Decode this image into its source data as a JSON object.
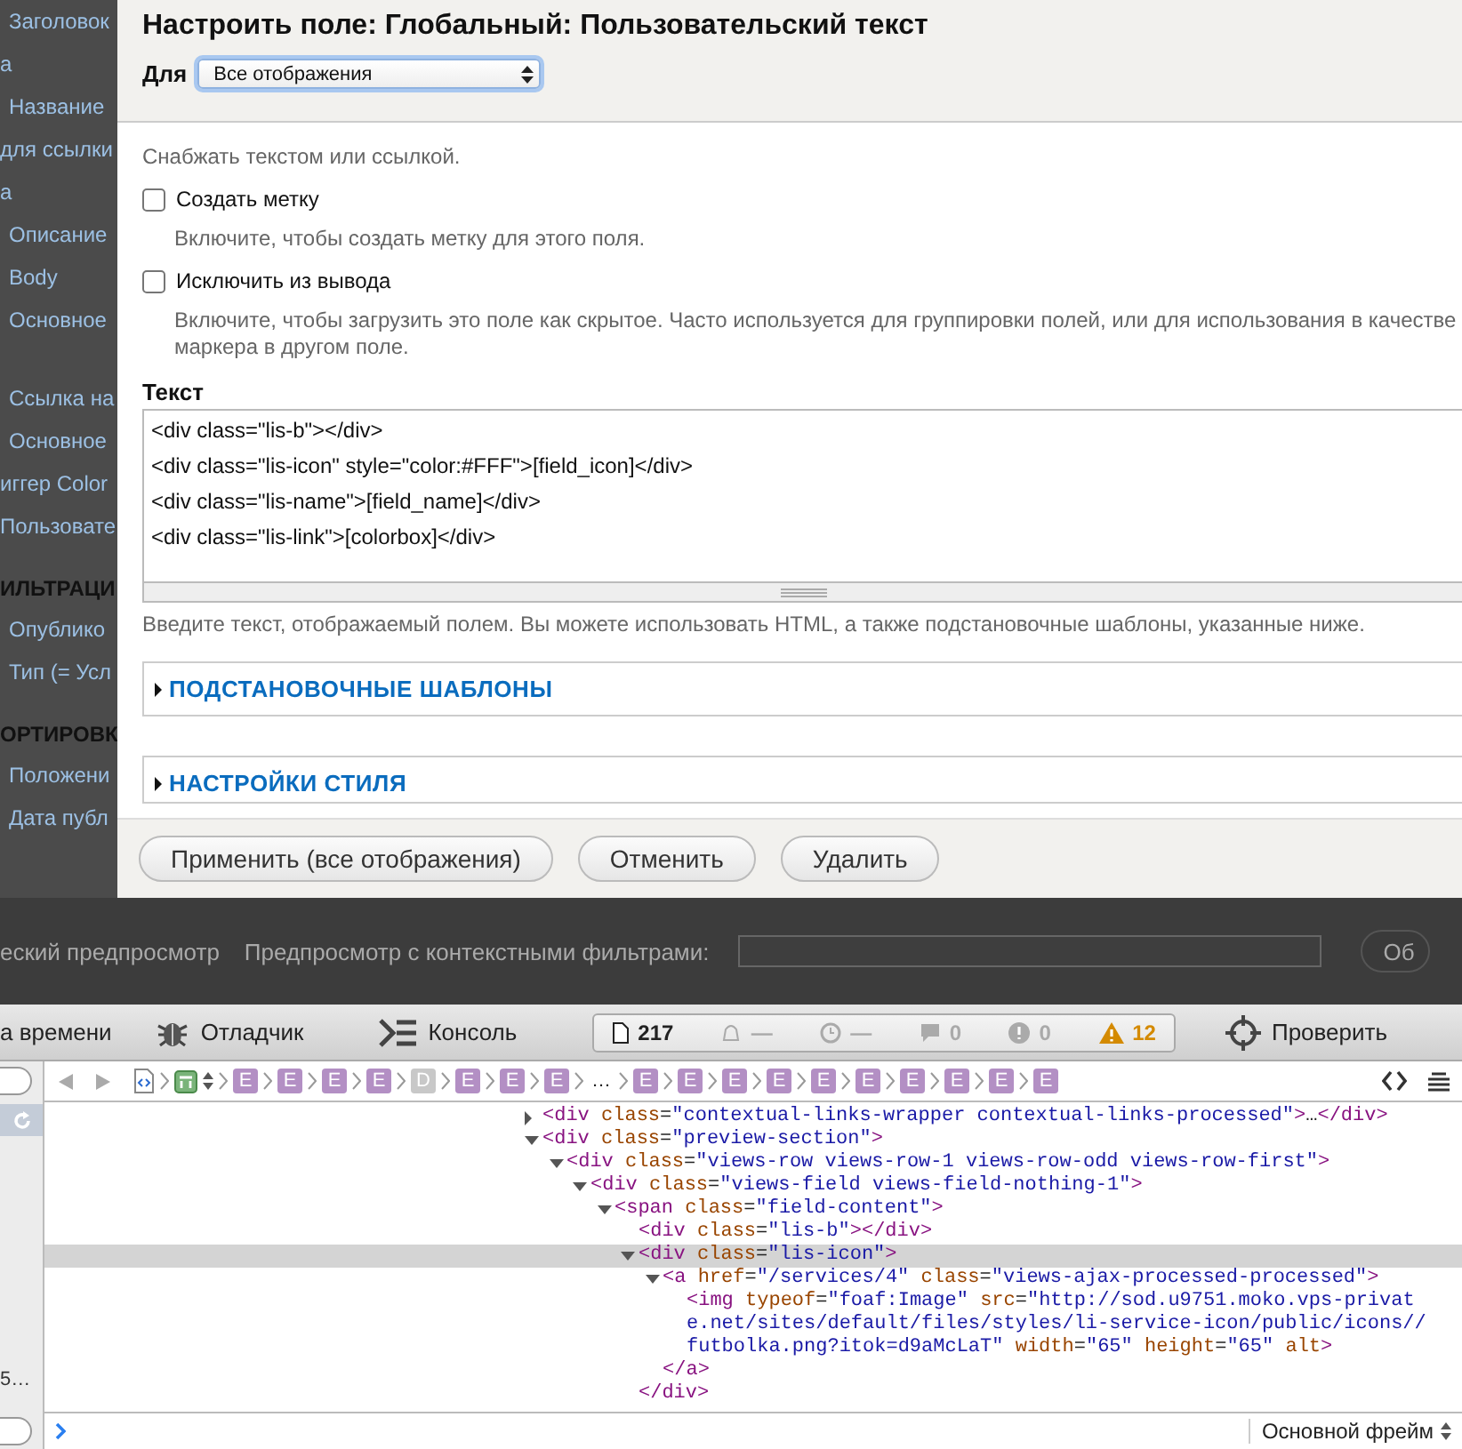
{
  "sidebar": {
    "groups": [
      {
        "items": [
          {
            "label": "Заголовок",
            "kind": "link"
          },
          {
            "label": "а",
            "kind": "continuation"
          },
          {
            "label": "Название",
            "kind": "link"
          },
          {
            "label": "для ссылки",
            "kind": "continuation"
          },
          {
            "label": "а",
            "kind": "continuation"
          },
          {
            "label": "Описание",
            "kind": "link"
          },
          {
            "label": "Body",
            "kind": "link"
          },
          {
            "label": "Основное",
            "kind": "link"
          }
        ]
      },
      {
        "items": [
          {
            "label": "Ссылка на",
            "kind": "link"
          },
          {
            "label": "Основное",
            "kind": "link"
          },
          {
            "label": "иггер Color",
            "kind": "continuation"
          },
          {
            "label": "Пользовате",
            "kind": "continuation"
          }
        ]
      },
      {
        "heading": "ИЛЬТРАЦИ",
        "items": [
          {
            "label": "Опублико",
            "kind": "link"
          },
          {
            "label": "Тип (= Усл",
            "kind": "link"
          }
        ]
      },
      {
        "heading": "ОРТИРОВК",
        "items": [
          {
            "label": "Положени",
            "kind": "link"
          },
          {
            "label": "Дата публ",
            "kind": "link"
          }
        ]
      }
    ]
  },
  "dialog": {
    "title": "Настроить поле: Глобальный: Пользовательский текст",
    "for_label": "Для",
    "for_select": "Все отображения",
    "description": "Снабжать текстом или ссылкой.",
    "options": [
      {
        "label": "Создать метку",
        "checked": false,
        "hint": "Включите, чтобы создать метку для этого поля."
      },
      {
        "label": "Исключить из вывода",
        "checked": false,
        "hint": "Включите, чтобы загрузить это поле как скрытое. Часто используется для группировки полей, или для использования в качестве маркера в другом поле."
      }
    ],
    "text_label": "Текст",
    "text_lines": [
      "<div class=\"lis-b\"></div>",
      "<div class=\"lis-icon\" style=\"color:#FFF\">[field_icon]</div>",
      "<div class=\"lis-name\">[field_name]</div>",
      "<div class=\"lis-link\">[colorbox]</div>"
    ],
    "text_hint": "Введите текст, отображаемый полем. Вы можете использовать HTML, а также подстановочные шаблоны, указанные ниже.",
    "sections": [
      {
        "label": "ПОДСТАНОВОЧНЫЕ ШАБЛОНЫ",
        "expanded": false
      },
      {
        "label": "НАСТРОЙКИ СТИЛЯ",
        "expanded": false
      }
    ],
    "buttons": [
      "Применить (все отображения)",
      "Отменить",
      "Удалить"
    ]
  },
  "preview_bar": {
    "left_text": "еский предпросмотр",
    "filter_label": "Предпросмотр с контекстными фильтрами:",
    "button": "Об"
  },
  "devtools": {
    "tabs": [
      {
        "label": "а времени",
        "kind": "timeline"
      },
      {
        "label": "Отладчик",
        "kind": "debugger"
      },
      {
        "label": "Консоль",
        "kind": "console"
      }
    ],
    "counters": [
      {
        "kind": "resources",
        "value": "217"
      },
      {
        "kind": "network",
        "value": "—"
      },
      {
        "kind": "time",
        "value": "—"
      },
      {
        "kind": "logs",
        "value": "0"
      },
      {
        "kind": "errors",
        "value": "0"
      },
      {
        "kind": "warnings",
        "value": "12"
      }
    ],
    "inspect": "Проверить",
    "breadcrumbs": [
      {
        "kind": "element",
        "label": "E"
      },
      {
        "kind": "element",
        "label": "E"
      },
      {
        "kind": "element",
        "label": "E"
      },
      {
        "kind": "element",
        "label": "E"
      },
      {
        "kind": "document",
        "label": "D"
      },
      {
        "kind": "element",
        "label": "E"
      },
      {
        "kind": "element",
        "label": "E"
      },
      {
        "kind": "element",
        "label": "E"
      },
      {
        "kind": "ellipsis",
        "label": "…"
      },
      {
        "kind": "element",
        "label": "E"
      },
      {
        "kind": "element",
        "label": "E"
      },
      {
        "kind": "element",
        "label": "E"
      },
      {
        "kind": "element",
        "label": "E"
      },
      {
        "kind": "element",
        "label": "E"
      },
      {
        "kind": "element",
        "label": "E"
      },
      {
        "kind": "element",
        "label": "E"
      },
      {
        "kind": "element",
        "label": "E"
      },
      {
        "kind": "element",
        "label": "E"
      },
      {
        "kind": "element",
        "label": "E"
      }
    ],
    "side_text": "5…",
    "dom": [
      {
        "text": "<div class=\"contextual-links-wrapper contextual-links-processed\">…</div>",
        "kind": "parent",
        "expanded": false,
        "selected": false
      },
      {
        "text": "<div class=\"preview-section\">",
        "kind": "parent",
        "expanded": true,
        "selected": false,
        "children": [
          {
            "text": "<div class=\"views-row views-row-1 views-row-odd views-row-first\">",
            "kind": "parent",
            "expanded": true,
            "selected": false,
            "children": [
              {
                "text": "<div class=\"views-field views-field-nothing-1\">",
                "kind": "parent",
                "expanded": true,
                "selected": false,
                "children": [
                  {
                    "text": "<span class=\"field-content\">",
                    "kind": "parent",
                    "expanded": true,
                    "selected": false,
                    "children": [
                      {
                        "text": "<div class=\"lis-b\"></div>",
                        "kind": "leaf",
                        "selected": false
                      },
                      {
                        "text": "<div class=\"lis-icon\">",
                        "kind": "parent",
                        "expanded": true,
                        "selected": true,
                        "closing": "</div>",
                        "children": [
                          {
                            "text": "<a href=\"/services/4\" class=\"views-ajax-processed-processed\">",
                            "kind": "parent",
                            "expanded": true,
                            "selected": false,
                            "closing": "</a>",
                            "children": [
                              {
                                "text": "<img typeof=\"foaf:Image\" src=\"http://sod.u9751.moko.vps-private.net/sites/default/files/styles/li-service-icon/public/icons//futbolka.png?itok=d9aMcLaT\" width=\"65\" height=\"65\" alt>",
                                "kind": "leaf",
                                "selected": false
                              }
                            ]
                          }
                        ]
                      }
                    ]
                  }
                ]
              }
            ]
          }
        ]
      }
    ],
    "frame": "Основной фрейм"
  }
}
